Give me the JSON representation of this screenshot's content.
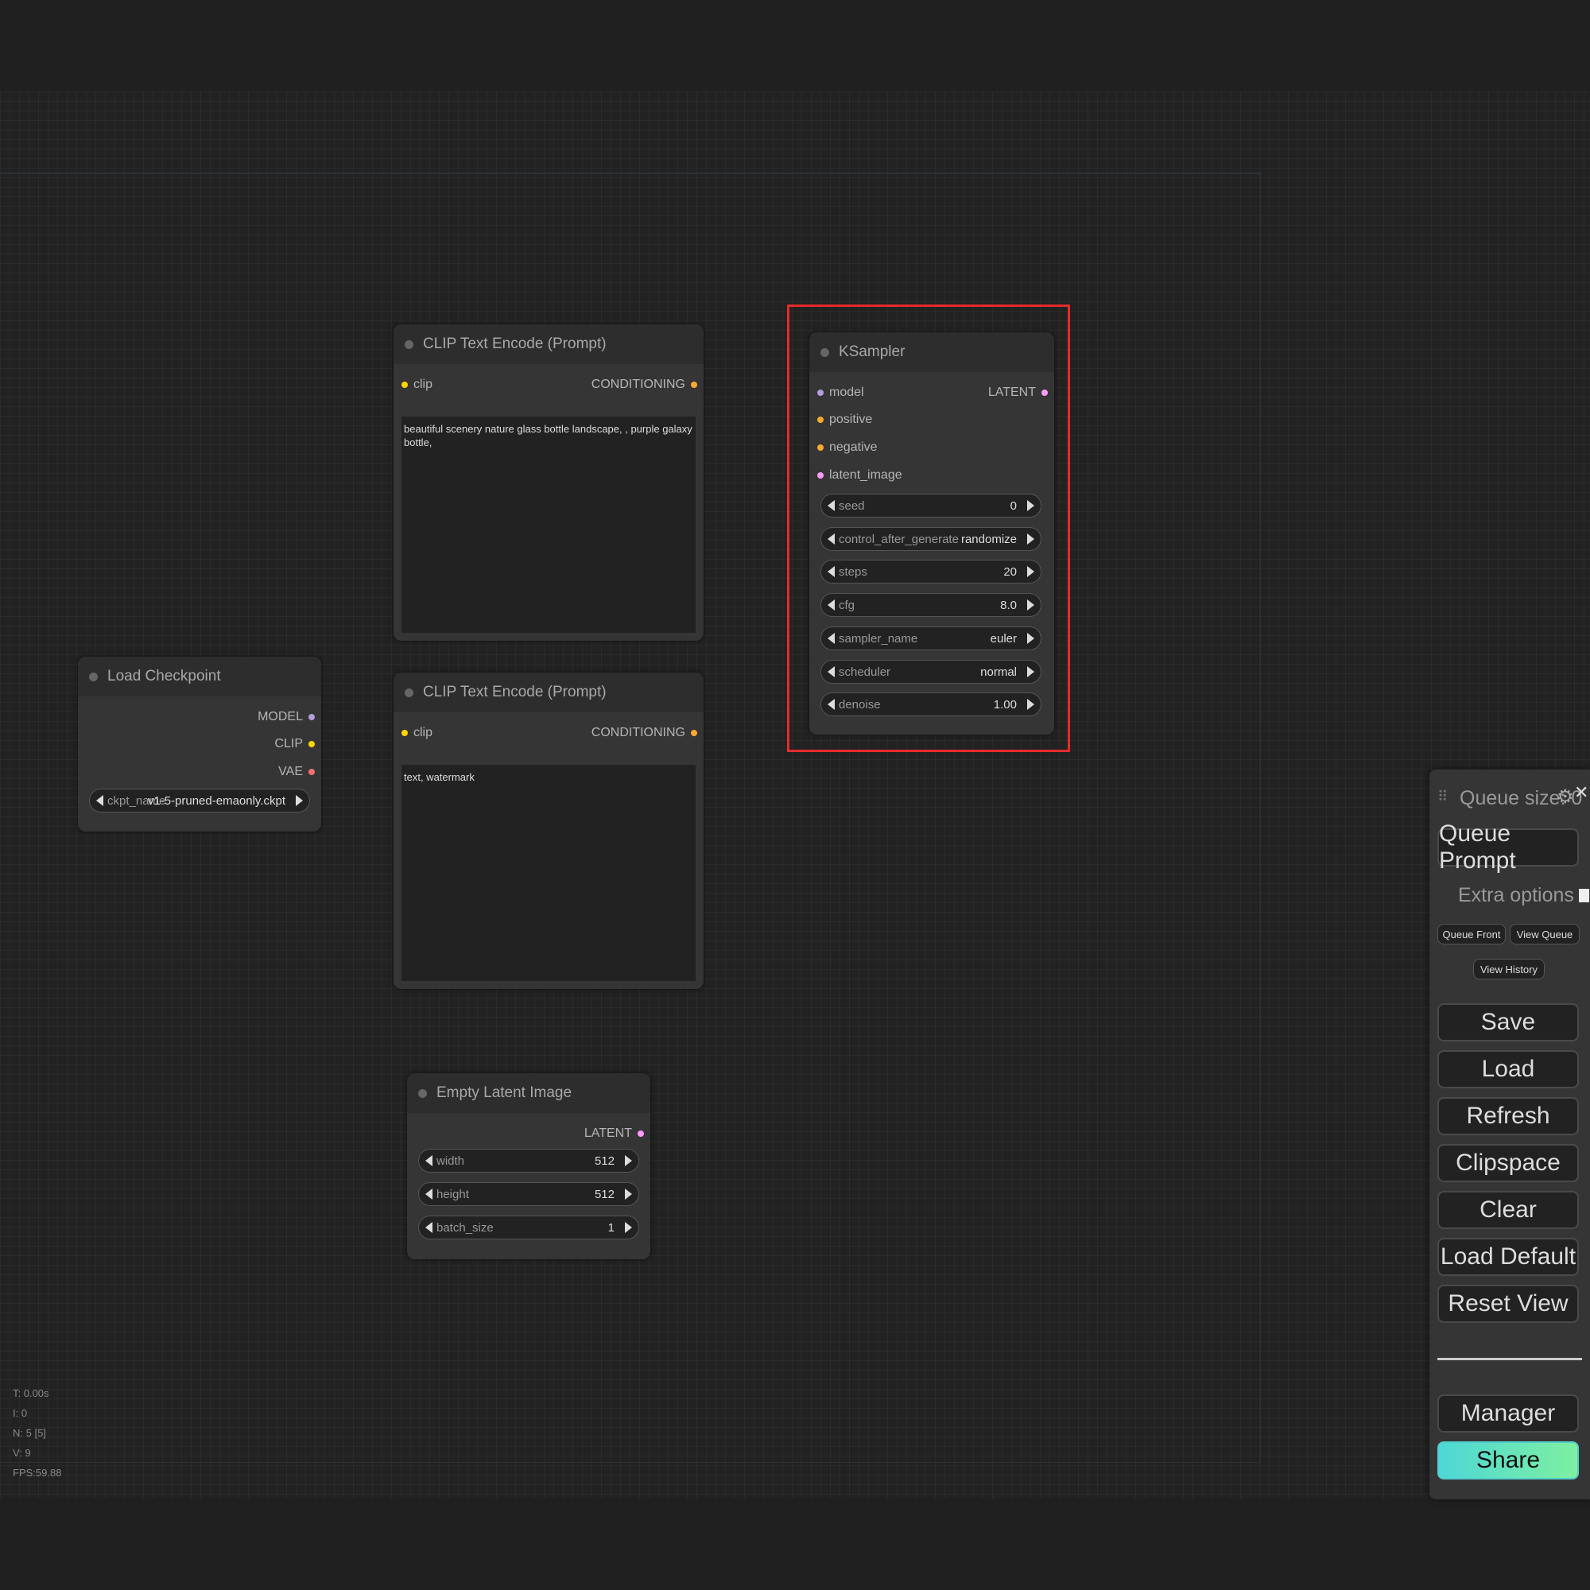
{
  "nodes": {
    "clip_pos": {
      "title": "CLIP Text Encode (Prompt)",
      "input_clip": "clip",
      "output": "CONDITIONING",
      "text": "beautiful scenery nature glass bottle landscape, , purple galaxy bottle,"
    },
    "clip_neg": {
      "title": "CLIP Text Encode (Prompt)",
      "input_clip": "clip",
      "output": "CONDITIONING",
      "text": "text, watermark"
    },
    "ksampler": {
      "title": "KSampler",
      "inputs": [
        "model",
        "positive",
        "negative",
        "latent_image"
      ],
      "output": "LATENT",
      "widgets": [
        {
          "label": "seed",
          "value": "0"
        },
        {
          "label": "control_after_generate",
          "value": "randomize"
        },
        {
          "label": "steps",
          "value": "20"
        },
        {
          "label": "cfg",
          "value": "8.0"
        },
        {
          "label": "sampler_name",
          "value": "euler"
        },
        {
          "label": "scheduler",
          "value": "normal"
        },
        {
          "label": "denoise",
          "value": "1.00"
        }
      ]
    },
    "load_checkpoint": {
      "title": "Load Checkpoint",
      "outputs": [
        "MODEL",
        "CLIP",
        "VAE"
      ],
      "widget": {
        "label": "ckpt_name",
        "value": "v1-5-pruned-emaonly.ckpt"
      }
    },
    "empty_latent": {
      "title": "Empty Latent Image",
      "output": "LATENT",
      "widgets": [
        {
          "label": "width",
          "value": "512"
        },
        {
          "label": "height",
          "value": "512"
        },
        {
          "label": "batch_size",
          "value": "1"
        }
      ]
    }
  },
  "stats": [
    "T: 0.00s",
    "I: 0",
    "N: 5 [5]",
    "V: 9",
    "FPS:59.88"
  ],
  "menu": {
    "queue_size": "Queue size: 0",
    "queue_prompt": "Queue Prompt",
    "extra_options": "Extra options",
    "queue_front": "Queue Front",
    "view_queue": "View Queue",
    "view_history": "View History",
    "save": "Save",
    "load": "Load",
    "refresh": "Refresh",
    "clipspace": "Clipspace",
    "clear": "Clear",
    "load_default": "Load Default",
    "reset_view": "Reset View",
    "manager": "Manager",
    "share": "Share"
  },
  "colors": {
    "clip_slot": "#ffd500",
    "conditioning_slot": "#ffa931",
    "model_slot": "#b39ddb",
    "vae_slot": "#ff6e6e",
    "latent_slot": "#ff9cf9",
    "highlight": "#e62b2b",
    "share_gradient_start": "#4dd7d7",
    "share_gradient_end": "#7ef0a0"
  }
}
